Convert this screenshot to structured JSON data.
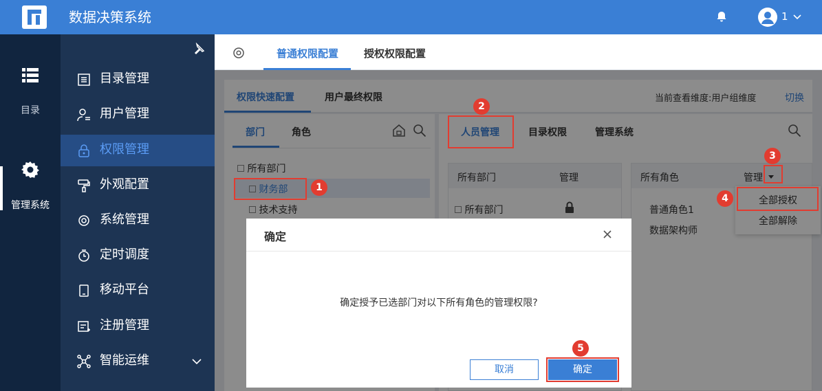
{
  "app": {
    "title": "数据决策系统",
    "user": "1"
  },
  "rail": {
    "items": [
      {
        "label": "目录"
      },
      {
        "label": "管理系统"
      }
    ]
  },
  "sidebar": {
    "items": [
      {
        "label": "目录管理"
      },
      {
        "label": "用户管理"
      },
      {
        "label": "权限管理"
      },
      {
        "label": "外观配置"
      },
      {
        "label": "系统管理"
      },
      {
        "label": "定时调度"
      },
      {
        "label": "移动平台"
      },
      {
        "label": "注册管理"
      },
      {
        "label": "智能运维"
      }
    ]
  },
  "tabs1": {
    "items": [
      "普通权限配置",
      "授权权限配置"
    ]
  },
  "tabs2": {
    "items": [
      "权限快速配置",
      "用户最终权限"
    ],
    "dimension": "当前查看维度:用户组维度",
    "switch": "切换"
  },
  "left": {
    "tabs": [
      "部门",
      "角色"
    ],
    "tree": [
      "所有部门",
      "财务部",
      "技术支持"
    ]
  },
  "right": {
    "tabs": [
      "人员管理",
      "目录权限",
      "管理系统"
    ],
    "table1": {
      "col1": "所有部门",
      "col2": "管理",
      "row": "所有部门"
    },
    "table2": {
      "col1": "所有角色",
      "col2": "管理",
      "rows": [
        "普通角色1",
        "数据架构师"
      ]
    },
    "menu": [
      "全部授权",
      "全部解除"
    ]
  },
  "dialog": {
    "title": "确定",
    "message": "确定授予已选部门对以下所有角色的管理权限?",
    "cancel": "取消",
    "ok": "确定"
  },
  "callouts": [
    "1",
    "2",
    "3",
    "4",
    "5"
  ],
  "colors": {
    "primary": "#3a7fd5",
    "rail": "#11253f",
    "sidebar": "#1d3453",
    "sidebar_active": "#264d85",
    "callout": "#e23c30"
  }
}
